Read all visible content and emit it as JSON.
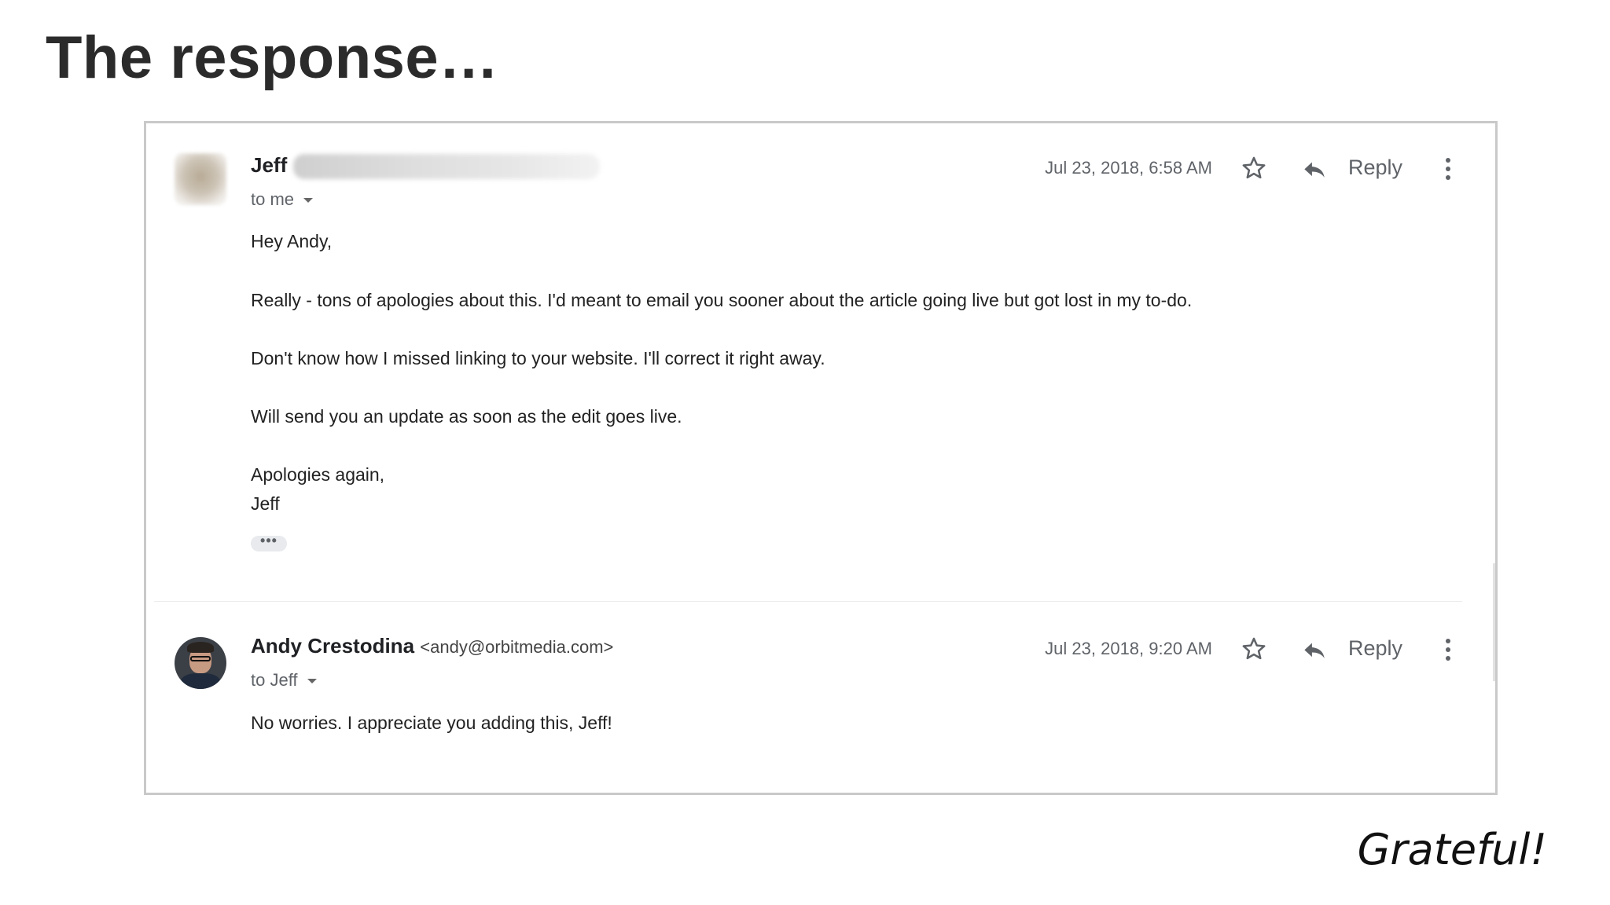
{
  "slide": {
    "title": "The response…",
    "caption": "Grateful!"
  },
  "messages": [
    {
      "sender_name": "Jeff",
      "sender_email": "",
      "to": "to me",
      "date": "Jul 23, 2018, 6:58 AM",
      "reply_label": "Reply",
      "body": [
        "Hey Andy,",
        "Really - tons of apologies about this. I'd meant to email you sooner about the article going live but got lost in my to-do.",
        "Don't know how I missed linking to your website. I'll correct it right away.",
        "Will send you an update as soon as the edit goes live.",
        "Apologies again,",
        "Jeff"
      ],
      "trimmed_indicator": "•••"
    },
    {
      "sender_name": "Andy Crestodina",
      "sender_email": "<andy@orbitmedia.com>",
      "to": "to Jeff",
      "date": "Jul 23, 2018, 9:20 AM",
      "reply_label": "Reply",
      "body": [
        "No worries. I appreciate you adding this, Jeff!"
      ]
    }
  ],
  "icons": {
    "star": "star-icon",
    "reply": "reply-icon",
    "more": "more-vert-icon",
    "dropdown": "caret-down-icon"
  },
  "colors": {
    "border": "#c9c9c9",
    "secondary_text": "#5f6368"
  }
}
